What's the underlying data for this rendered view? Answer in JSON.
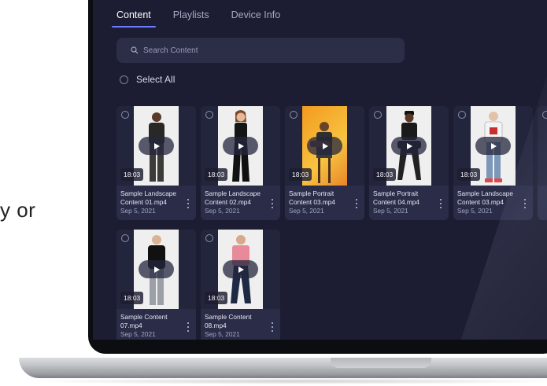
{
  "side_text": "y or",
  "tabs": [
    {
      "label": "Content",
      "active": true
    },
    {
      "label": "Playlists",
      "active": false
    },
    {
      "label": "Device Info",
      "active": false
    }
  ],
  "search": {
    "placeholder": "Search Content",
    "icon": "search-icon"
  },
  "select_all": {
    "label": "Select All"
  },
  "cards": [
    {
      "duration": "18:03",
      "name_line1": "Sample Landscape",
      "name_line2": "Content 01.mp4",
      "date": "Sep 5, 2021"
    },
    {
      "duration": "18:03",
      "name_line1": "Sample Landscape",
      "name_line2": "Content 02.mp4",
      "date": "Sep 5, 2021"
    },
    {
      "duration": "18:03",
      "name_line1": "Sample Portrait",
      "name_line2": "Content 03.mp4",
      "date": "Sep 5, 2021"
    },
    {
      "duration": "18:03",
      "name_line1": "Sample Portrait",
      "name_line2": "Content 04.mp4",
      "date": "Sep 5, 2021"
    },
    {
      "duration": "18:03",
      "name_line1": "Sample Landscape",
      "name_line2": "Content 03.mp4",
      "date": "Sep 5, 2021"
    },
    {
      "duration": "18:03",
      "name_line1": "Sample Content",
      "name_line2": "07.mp4",
      "date": "Sep 5, 2021"
    },
    {
      "duration": "18:03",
      "name_line1": "Sample Content",
      "name_line2": "08.mp4",
      "date": "Sep 5, 2021"
    }
  ],
  "colors": {
    "screen_bg": "#1c1d33",
    "card_bg": "#2a2c48",
    "accent": "#6d7bff"
  }
}
